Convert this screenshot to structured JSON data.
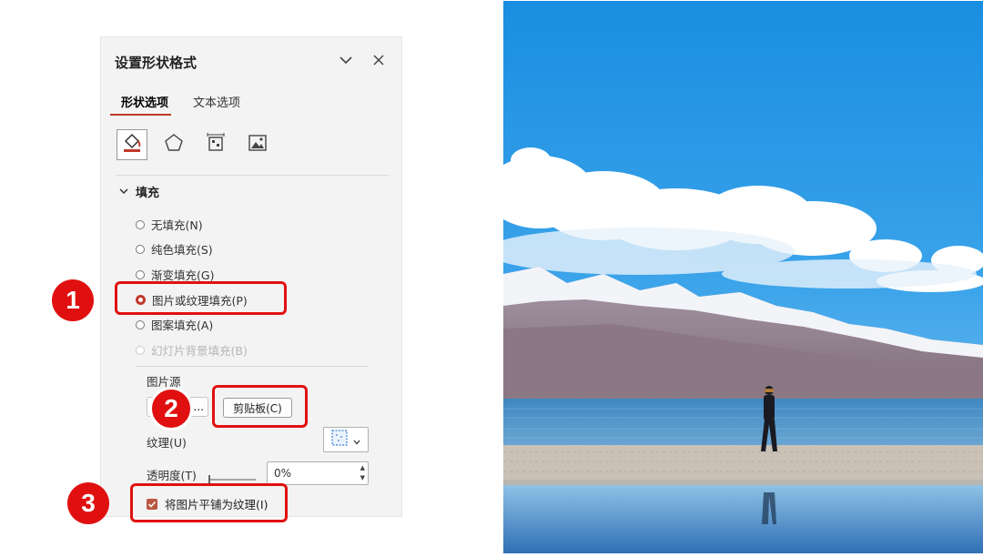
{
  "panel": {
    "title": "设置形状格式",
    "collapse_icon": "chevron-down-icon",
    "close_icon": "close-icon",
    "tabs": [
      {
        "label": "形状选项",
        "active": true
      },
      {
        "label": "文本选项",
        "active": false
      }
    ],
    "icon_tabs": [
      {
        "icon": "fill-bucket-icon",
        "active": true
      },
      {
        "icon": "pentagon-icon",
        "active": false
      },
      {
        "icon": "size-properties-icon",
        "active": false
      },
      {
        "icon": "picture-icon",
        "active": false
      }
    ],
    "section": {
      "label": "填充",
      "expanded": true
    },
    "fill_options": [
      {
        "label": "无填充(N)",
        "checked": false,
        "disabled": false
      },
      {
        "label": "纯色填充(S)",
        "checked": false,
        "disabled": false
      },
      {
        "label": "渐变填充(G)",
        "checked": false,
        "disabled": false
      },
      {
        "label": "图片或纹理填充(P)",
        "checked": true,
        "disabled": false
      },
      {
        "label": "图案填充(A)",
        "checked": false,
        "disabled": false
      },
      {
        "label": "幻灯片背景填充(B)",
        "checked": false,
        "disabled": true
      }
    ],
    "picture_source": {
      "label": "图片源",
      "insert_suffix": "...",
      "clipboard_button": "剪贴板(C)"
    },
    "texture": {
      "label": "纹理(U)"
    },
    "transparency": {
      "label": "透明度(T)",
      "value": "0%"
    },
    "tile_checkbox": {
      "label": "将图片平铺为纹理(I)",
      "checked": true
    }
  },
  "callouts": [
    {
      "number": "1"
    },
    {
      "number": "2"
    },
    {
      "number": "3"
    }
  ],
  "colors": {
    "accent": "#c0392b",
    "callout_red": "#e01010",
    "panel_bg": "#f3f3f3"
  },
  "photo": {
    "description_icon": "landscape-photo"
  }
}
